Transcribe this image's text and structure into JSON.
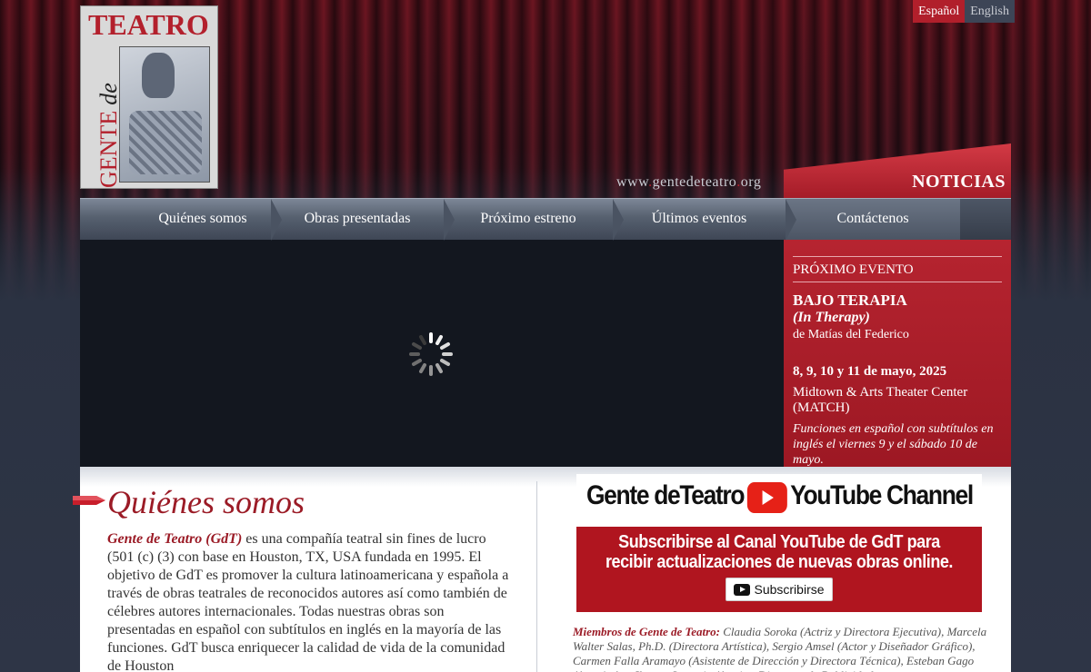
{
  "language": {
    "spanish": "Español",
    "english": "English"
  },
  "logo": {
    "teatro": "TEATRO",
    "gente": "GENTE",
    "de": "de"
  },
  "url": {
    "pre": "www",
    "name": "gentedeteatro",
    "tld": "org"
  },
  "noticias": "NOTICIAS",
  "nav": [
    {
      "label": "Quiénes somos"
    },
    {
      "label": "Obras presentadas"
    },
    {
      "label": "Próximo estreno"
    },
    {
      "label": "Últimos eventos"
    },
    {
      "label": "Contáctenos"
    }
  ],
  "event": {
    "kicker": "PRÓXIMO EVENTO",
    "title": "BAJO TERAPIA",
    "subtitle": "(In Therapy)",
    "author": "de Matías del Federico",
    "dates": "8, 9, 10 y 11 de mayo, 2025",
    "venue": "Midtown & Arts Theater Center (MATCH)",
    "note": "Funciones en español con subtítulos en inglés el viernes 9 y el sábado 10 de mayo."
  },
  "about": {
    "heading": "Quiénes somos",
    "gdt_name": "Gente de Teatro (GdT)",
    "text": " es una compañía teatral sin fines de lucro (501 (c) (3) con base en Houston, TX, USA fundada en 1995. El objetivo de GdT es promover la cultura latinoamericana y española a través de obras teatrales de reconocidos autores así como también de célebres autores internacionales. Todas nuestras obras son presentadas en español con subtítulos en inglés en la mayoría de las funciones. GdT busca enriquecer la calidad de vida de la comunidad de Houston"
  },
  "youtube": {
    "brand_left": "Gente deTeatro",
    "brand_right": "YouTube Channel",
    "message": "Subscribirse al Canal YouTube de GdT para recibir actualizaciones de nuevas obras online.",
    "button": "Subscribirse"
  },
  "members": {
    "label": "Miembros de Gente de Teatro:",
    "text": " Claudia Soroka (Actriz y Directora Ejecutiva), Marcela Walter Salas, Ph.D. (Directora Artística), Sergio Amsel (Actor y Diseñador Gráfico), Carmen Falla Aramayo (Asistente de Dirección y Directora Técnica), Esteban Gago (Actor), Ana Ilyanto Scuseria (Actriz y Directora de Publicidad y"
  },
  "colors": {
    "accent": "#b3202c",
    "nav": "#56606f",
    "panel": "#b62430"
  }
}
